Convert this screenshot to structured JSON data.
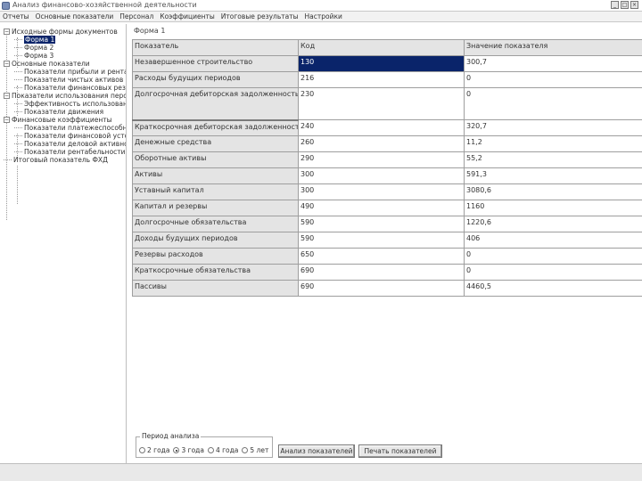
{
  "window": {
    "title": "Анализ финансово-хозяйственной деятельности",
    "minimize": "_",
    "maximize": "□",
    "close": "×"
  },
  "menu": [
    "Отчеты",
    "Основные показатели",
    "Персонал",
    "Коэффициенты",
    "Итоговые результаты",
    "Настройки"
  ],
  "tree": {
    "items": [
      {
        "label": "Исходные формы документов",
        "toggle": "−",
        "level": 0
      },
      {
        "label": "Форма 1",
        "level": 1,
        "selected": true
      },
      {
        "label": "Форма 2",
        "level": 1
      },
      {
        "label": "Форма 3",
        "level": 1
      },
      {
        "label": "Основные показатели",
        "toggle": "−",
        "level": 0
      },
      {
        "label": "Показатели прибыли и рентабельности",
        "level": 1
      },
      {
        "label": "Показатели чистых активов",
        "level": 1
      },
      {
        "label": "Показатели финансовых результатов",
        "level": 1
      },
      {
        "label": "Показатели использования персонала",
        "toggle": "−",
        "level": 0
      },
      {
        "label": "Эффективность использования",
        "level": 1
      },
      {
        "label": "Показатели движения",
        "level": 1
      },
      {
        "label": "Финансовые коэффициенты",
        "toggle": "−",
        "level": 0
      },
      {
        "label": "Показатели платежеспособности",
        "level": 1
      },
      {
        "label": "Показатели финансовой устойчивости",
        "level": 1
      },
      {
        "label": "Показатели деловой активности",
        "level": 1
      },
      {
        "label": "Показатели рентабельности",
        "level": 1
      },
      {
        "label": "Итоговый показатель ФХД",
        "level": 0
      }
    ]
  },
  "panel": {
    "label": "Форма 1"
  },
  "table": {
    "headers": [
      "Показатель",
      "Код",
      "Значение показателя"
    ],
    "rows": [
      {
        "name": "Незавершенное строительство",
        "code": "130",
        "value": "300,7",
        "code_selected": true
      },
      {
        "name": "Расходы будущих периодов",
        "code": "216",
        "value": "0"
      },
      {
        "name": "Долгосрочная дебиторская задолженность",
        "code": "230",
        "value": "0",
        "tall": true
      },
      {
        "name": "Краткосрочная дебиторская задолженность",
        "code": "240",
        "value": "320,7"
      },
      {
        "name": "Денежные средства",
        "code": "260",
        "value": "11,2"
      },
      {
        "name": "Оборотные активы",
        "code": "290",
        "value": "55,2"
      },
      {
        "name": "Активы",
        "code": "300",
        "value": "591,3"
      },
      {
        "name": "Уставный капитал",
        "code": "300",
        "value": "3080,6"
      },
      {
        "name": "Капитал и резервы",
        "code": "490",
        "value": "1160"
      },
      {
        "name": "Долгосрочные обязательства",
        "code": "590",
        "value": "1220,6"
      },
      {
        "name": "Доходы будущих периодов",
        "code": "590",
        "value": "406"
      },
      {
        "name": "Резервы расходов",
        "code": "650",
        "value": "0"
      },
      {
        "name": "Краткосрочные обязательства",
        "code": "690",
        "value": "0"
      },
      {
        "name": "Пассивы",
        "code": "690",
        "value": "4460,5"
      }
    ]
  },
  "period": {
    "title": "Период анализа",
    "options": [
      {
        "label": "2 года",
        "checked": false
      },
      {
        "label": "3 года",
        "checked": true
      },
      {
        "label": "4 года",
        "checked": false
      },
      {
        "label": "5 лет",
        "checked": false
      }
    ]
  },
  "buttons": {
    "analyze": "Анализ показателей",
    "print": "Печать показателей"
  }
}
